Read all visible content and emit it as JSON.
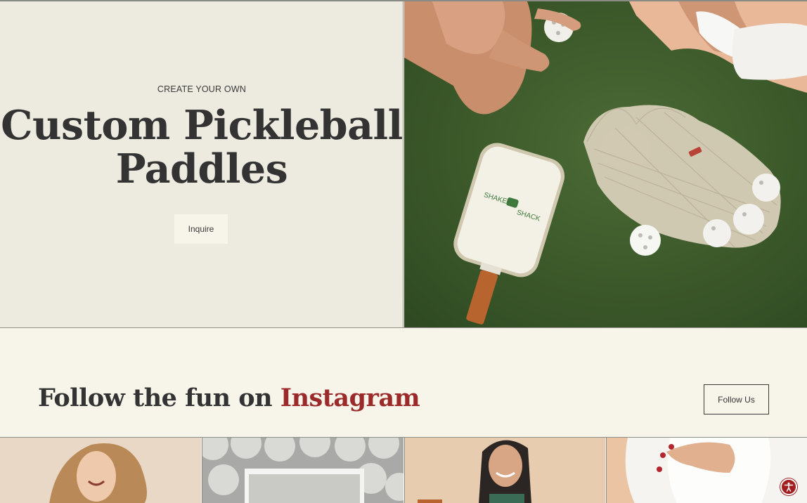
{
  "hero": {
    "eyebrow": "CREATE YOUR OWN",
    "title_line1": "Custom Pickleball",
    "title_line2": "Paddles",
    "cta_label": "Inquire",
    "image_paddle_brand": "SHAKE SHACK"
  },
  "instagram": {
    "heading_prefix": "Follow the fun on ",
    "heading_accent": "Instagram",
    "follow_label": "Follow Us"
  },
  "colors": {
    "accent_red": "#9b2a2a",
    "court_green": "#3c5a2c",
    "cream": "#f7f4ea",
    "hero_panel": "#edeadf"
  },
  "icons": {
    "accessibility": "accessibility-icon"
  }
}
